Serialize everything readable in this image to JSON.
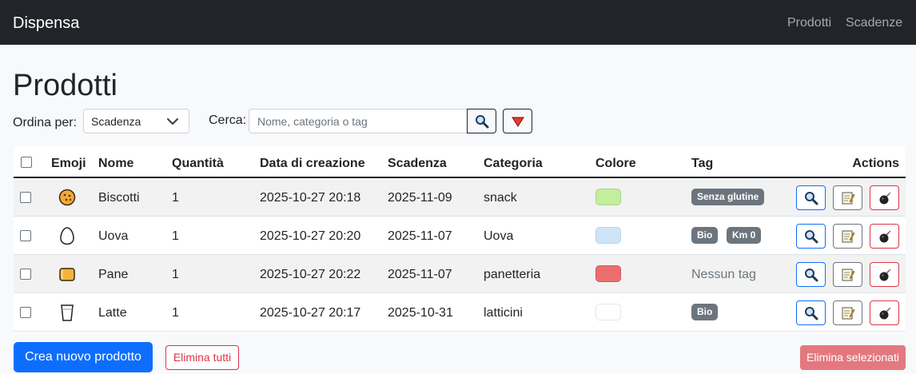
{
  "navbar": {
    "brand": "Dispensa",
    "links": [
      "Prodotti",
      "Scadenze"
    ]
  },
  "page_title": "Prodotti",
  "toolbar": {
    "sort_label": "Ordina per:",
    "sort_value": "Scadenza",
    "search_label": "Cerca:",
    "search_placeholder": "Nome, categoria o tag",
    "search_value": ""
  },
  "table": {
    "headers": [
      "Emoji",
      "Nome",
      "Quantità",
      "Data di creazione",
      "Scadenza",
      "Categoria",
      "Colore",
      "Tag",
      "Actions"
    ],
    "rows": [
      {
        "emoji": "cookie-icon",
        "name": "Biscotti",
        "quantity": "1",
        "created": "2025-10-27 20:18",
        "expiry": "2025-11-09",
        "category": "snack",
        "color": "#c3ee9c",
        "tags": [
          "Senza glutine"
        ],
        "no_tag": ""
      },
      {
        "emoji": "egg-icon",
        "name": "Uova",
        "quantity": "1",
        "created": "2025-10-27 20:20",
        "expiry": "2025-11-07",
        "category": "Uova",
        "color": "#cfe5f7",
        "tags": [
          "Bio",
          "Km 0"
        ],
        "no_tag": ""
      },
      {
        "emoji": "bread-icon",
        "name": "Pane",
        "quantity": "1",
        "created": "2025-10-27 20:22",
        "expiry": "2025-11-07",
        "category": "panetteria",
        "color": "#ea6e6e",
        "tags": [],
        "no_tag": "Nessun tag"
      },
      {
        "emoji": "milk-glass-icon",
        "name": "Latte",
        "quantity": "1",
        "created": "2025-10-27 20:17",
        "expiry": "2025-10-31",
        "category": "latticini",
        "color": "#ffffff",
        "tags": [
          "Bio"
        ],
        "no_tag": ""
      }
    ]
  },
  "footer": {
    "create_label": "Crea nuovo prodotto",
    "delete_all_label": "Elimina tutti",
    "delete_selected_label": "Elimina selezionati"
  },
  "colors": {
    "primary": "#0d6efd",
    "danger": "#dc3545",
    "navbar": "#212529",
    "badge": "#6c757d"
  }
}
